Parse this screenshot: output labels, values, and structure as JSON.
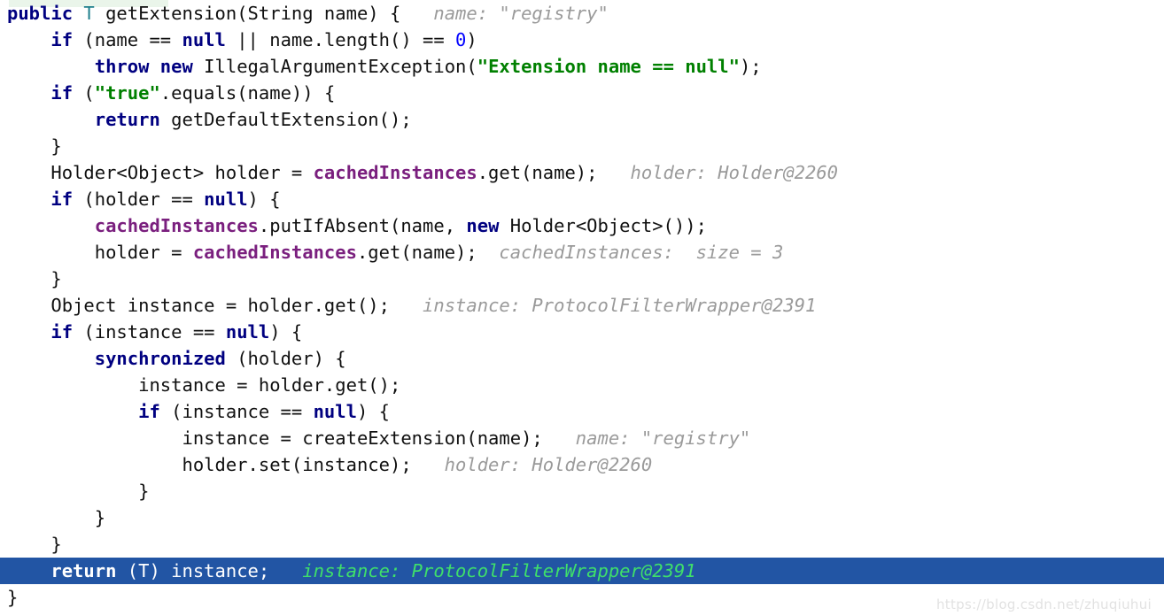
{
  "editor": {
    "language": "java",
    "colors": {
      "background": "#ffffff",
      "foreground": "#101010",
      "keyword": "#000080",
      "type_param": "#20808d",
      "string": "#008000",
      "number": "#0000ff",
      "field": "#7a1f7e",
      "inline_hint": "#9a9a9a",
      "selection_background": "#2255a4",
      "selection_foreground": "#ffffff",
      "selection_hint": "#3fe06a",
      "executed_line_band": "#eaf5ea",
      "watermark": "#e2e2e2"
    },
    "watermark": "https://blog.csdn.net/zhuqiuhui",
    "lines": [
      {
        "id": "line-1",
        "selected": false,
        "tokens": [
          {
            "t": "public",
            "c": "kw"
          },
          {
            "t": " ",
            "c": "plain"
          },
          {
            "t": "T",
            "c": "type"
          },
          {
            "t": " getExtension(String name) {",
            "c": "plain"
          },
          {
            "t": "   name: \"registry\"",
            "c": "hint"
          }
        ]
      },
      {
        "id": "line-2",
        "selected": false,
        "tokens": [
          {
            "t": "    ",
            "c": "plain"
          },
          {
            "t": "if",
            "c": "kw"
          },
          {
            "t": " (name == ",
            "c": "plain"
          },
          {
            "t": "null",
            "c": "kw"
          },
          {
            "t": " || name.length() == ",
            "c": "plain"
          },
          {
            "t": "0",
            "c": "num"
          },
          {
            "t": ")",
            "c": "plain"
          }
        ]
      },
      {
        "id": "line-3",
        "selected": false,
        "tokens": [
          {
            "t": "        ",
            "c": "plain"
          },
          {
            "t": "throw new",
            "c": "kw"
          },
          {
            "t": " IllegalArgumentException(",
            "c": "plain"
          },
          {
            "t": "\"Extension name == null\"",
            "c": "str"
          },
          {
            "t": ");",
            "c": "plain"
          }
        ]
      },
      {
        "id": "line-4",
        "selected": false,
        "tokens": [
          {
            "t": "    ",
            "c": "plain"
          },
          {
            "t": "if",
            "c": "kw"
          },
          {
            "t": " (",
            "c": "plain"
          },
          {
            "t": "\"true\"",
            "c": "str"
          },
          {
            "t": ".equals(name)) {",
            "c": "plain"
          }
        ]
      },
      {
        "id": "line-5",
        "selected": false,
        "tokens": [
          {
            "t": "        ",
            "c": "plain"
          },
          {
            "t": "return",
            "c": "kw"
          },
          {
            "t": " getDefaultExtension();",
            "c": "plain"
          }
        ]
      },
      {
        "id": "line-6",
        "selected": false,
        "tokens": [
          {
            "t": "    }",
            "c": "plain"
          }
        ]
      },
      {
        "id": "line-7",
        "selected": false,
        "tokens": [
          {
            "t": "    Holder<Object> holder = ",
            "c": "plain"
          },
          {
            "t": "cachedInstances",
            "c": "field"
          },
          {
            "t": ".get(name);",
            "c": "plain"
          },
          {
            "t": "   holder: Holder@2260",
            "c": "hint"
          }
        ]
      },
      {
        "id": "line-8",
        "selected": false,
        "tokens": [
          {
            "t": "    ",
            "c": "plain"
          },
          {
            "t": "if",
            "c": "kw"
          },
          {
            "t": " (holder == ",
            "c": "plain"
          },
          {
            "t": "null",
            "c": "kw"
          },
          {
            "t": ") {",
            "c": "plain"
          }
        ]
      },
      {
        "id": "line-9",
        "selected": false,
        "tokens": [
          {
            "t": "        ",
            "c": "plain"
          },
          {
            "t": "cachedInstances",
            "c": "field"
          },
          {
            "t": ".putIfAbsent(name, ",
            "c": "plain"
          },
          {
            "t": "new",
            "c": "kw"
          },
          {
            "t": " Holder<Object>());",
            "c": "plain"
          }
        ]
      },
      {
        "id": "line-10",
        "selected": false,
        "tokens": [
          {
            "t": "        holder = ",
            "c": "plain"
          },
          {
            "t": "cachedInstances",
            "c": "field"
          },
          {
            "t": ".get(name);",
            "c": "plain"
          },
          {
            "t": "  cachedInstances:  size = 3",
            "c": "hint"
          }
        ]
      },
      {
        "id": "line-11",
        "selected": false,
        "tokens": [
          {
            "t": "    }",
            "c": "plain"
          }
        ]
      },
      {
        "id": "line-12",
        "selected": false,
        "tokens": [
          {
            "t": "    Object instance = holder.get();",
            "c": "plain"
          },
          {
            "t": "   instance: ProtocolFilterWrapper@2391",
            "c": "hint"
          }
        ]
      },
      {
        "id": "line-13",
        "selected": false,
        "tokens": [
          {
            "t": "    ",
            "c": "plain"
          },
          {
            "t": "if",
            "c": "kw"
          },
          {
            "t": " (instance == ",
            "c": "plain"
          },
          {
            "t": "null",
            "c": "kw"
          },
          {
            "t": ") {",
            "c": "plain"
          }
        ]
      },
      {
        "id": "line-14",
        "selected": false,
        "tokens": [
          {
            "t": "        ",
            "c": "plain"
          },
          {
            "t": "synchronized",
            "c": "kw"
          },
          {
            "t": " (holder) {",
            "c": "plain"
          }
        ]
      },
      {
        "id": "line-15",
        "selected": false,
        "tokens": [
          {
            "t": "            instance = holder.get();",
            "c": "plain"
          }
        ]
      },
      {
        "id": "line-16",
        "selected": false,
        "tokens": [
          {
            "t": "            ",
            "c": "plain"
          },
          {
            "t": "if",
            "c": "kw"
          },
          {
            "t": " (instance == ",
            "c": "plain"
          },
          {
            "t": "null",
            "c": "kw"
          },
          {
            "t": ") {",
            "c": "plain"
          }
        ]
      },
      {
        "id": "line-17",
        "selected": false,
        "tokens": [
          {
            "t": "                instance = createExtension(name);",
            "c": "plain"
          },
          {
            "t": "   name: \"registry\"",
            "c": "hint"
          }
        ]
      },
      {
        "id": "line-18",
        "selected": false,
        "tokens": [
          {
            "t": "                holder.set(instance);",
            "c": "plain"
          },
          {
            "t": "   holder: Holder@2260",
            "c": "hint"
          }
        ]
      },
      {
        "id": "line-19",
        "selected": false,
        "tokens": [
          {
            "t": "            }",
            "c": "plain"
          }
        ]
      },
      {
        "id": "line-20",
        "selected": false,
        "tokens": [
          {
            "t": "        }",
            "c": "plain"
          }
        ]
      },
      {
        "id": "line-21",
        "selected": false,
        "tokens": [
          {
            "t": "    }",
            "c": "plain"
          }
        ]
      },
      {
        "id": "line-22",
        "selected": true,
        "tokens": [
          {
            "t": "    ",
            "c": "plain"
          },
          {
            "t": "return",
            "c": "kw"
          },
          {
            "t": " (T) instance;",
            "c": "plain"
          },
          {
            "t": "   instance: ProtocolFilterWrapper@2391",
            "c": "hint"
          }
        ]
      },
      {
        "id": "line-23",
        "selected": false,
        "tokens": [
          {
            "t": "}",
            "c": "plain"
          }
        ]
      }
    ]
  }
}
